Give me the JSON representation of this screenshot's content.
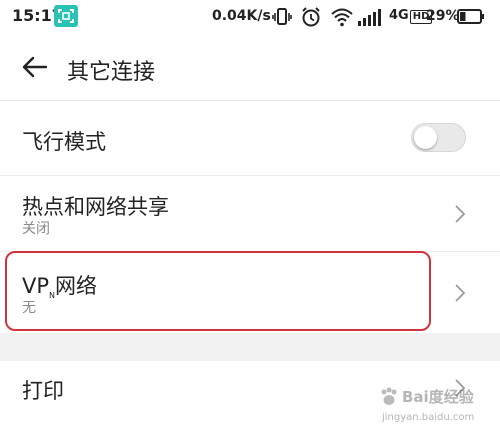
{
  "status_bar": {
    "time": "15:17",
    "net_speed": "0.04K/s",
    "network_type": "4G",
    "hd_badge": "HD",
    "battery_percent": "29%",
    "battery_level": 0.29,
    "icons": [
      "screenshot-scan-icon",
      "vibrate-icon",
      "alarm-icon",
      "wifi-icon",
      "signal-icon",
      "battery-icon"
    ]
  },
  "header": {
    "title": "其它连接",
    "back_icon": "back-arrow-icon"
  },
  "items": [
    {
      "title": "飞行模式",
      "control": "toggle",
      "toggle_on": false
    },
    {
      "title": "热点和网络共享",
      "subtitle": "关闭",
      "control": "chevron"
    },
    {
      "title_prefix": "VP",
      "title_sub": "N",
      "title_suffix": "网络",
      "subtitle": "无",
      "control": "chevron",
      "highlighted": true
    },
    {
      "title": "打印",
      "control": "chevron"
    }
  ],
  "watermark": {
    "text": "Bai度经验",
    "url": "jingyan.baidu.com"
  },
  "colors": {
    "accent_scan": "#27c3b4",
    "highlight_border": "#d0353f",
    "section_gap": "#f2f2f2"
  }
}
